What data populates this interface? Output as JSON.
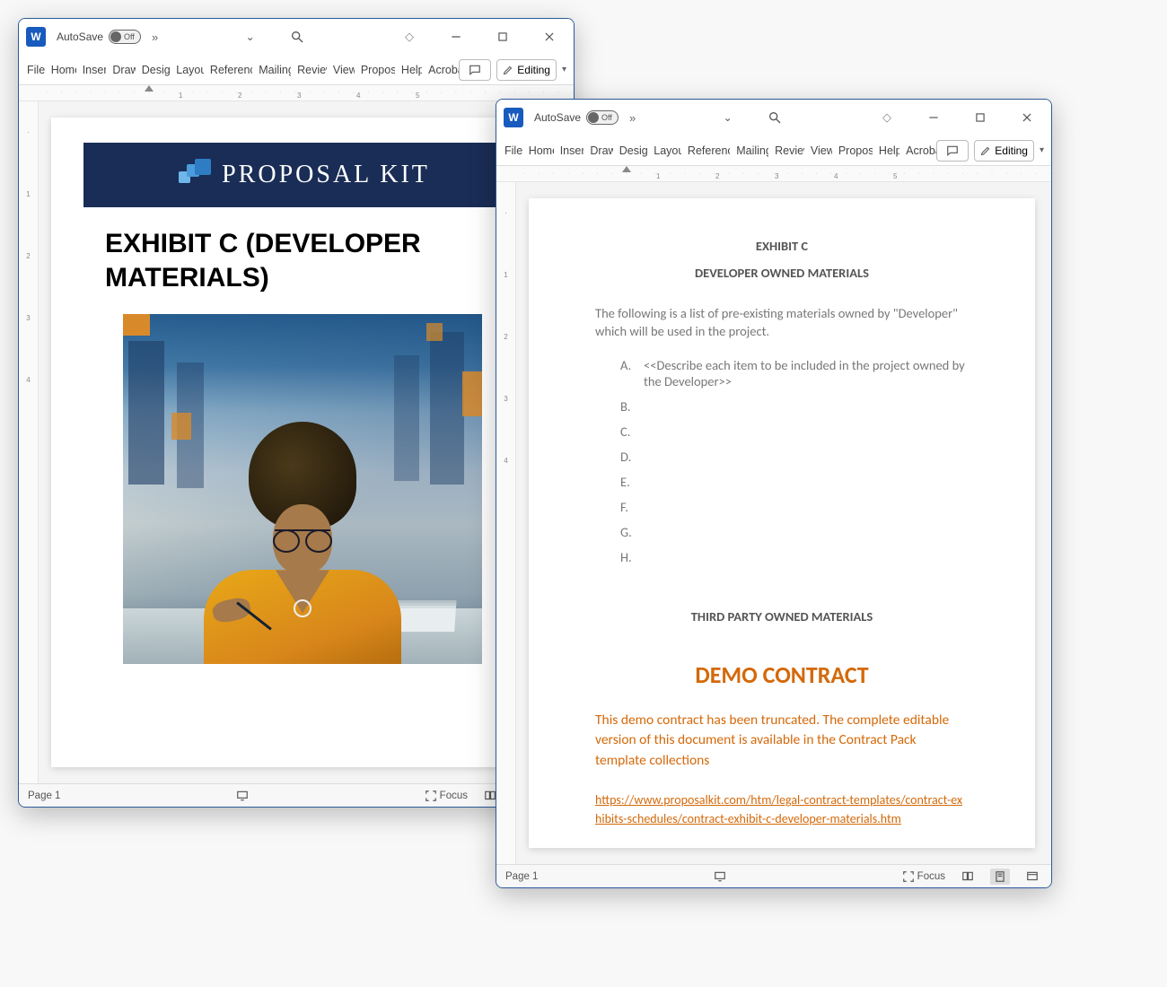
{
  "windows": {
    "win1": {
      "autosave_label": "AutoSave",
      "autosave_state": "Off",
      "ribbon_tabs": [
        "File",
        "Home",
        "Insert",
        "Draw",
        "Design",
        "Layout",
        "References",
        "Mailings",
        "Review",
        "View",
        "Proposal",
        "Help",
        "Acrobat"
      ],
      "editing_label": "Editing",
      "status_page": "Page 1",
      "status_focus": "Focus"
    },
    "win2": {
      "autosave_label": "AutoSave",
      "autosave_state": "Off",
      "ribbon_tabs": [
        "File",
        "Home",
        "Insert",
        "Draw",
        "Design",
        "Layout",
        "References",
        "Mailings",
        "Review",
        "View",
        "Proposal",
        "Help",
        "Acrobat"
      ],
      "editing_label": "Editing",
      "status_page": "Page 1",
      "status_focus": "Focus"
    }
  },
  "doc1": {
    "banner_brand": "PROPOSAL KIT",
    "title": "EXHIBIT C (DEVELOPER MATERIALS)"
  },
  "doc2": {
    "heading1": "EXHIBIT C",
    "heading2": "DEVELOPER OWNED MATERIALS",
    "intro": "The following is a list of pre-existing materials owned by \"Developer\" which will be used in the project.",
    "list": {
      "a": "<<Describe each item to be included in the project owned by the Developer>>",
      "b": "",
      "c": "",
      "d": "",
      "e": "",
      "f": "",
      "g": "",
      "h": ""
    },
    "heading3": "THIRD PARTY OWNED MATERIALS",
    "demo_title": "DEMO CONTRACT",
    "demo_body": "This demo contract has been truncated. The complete editable version of this document is available in the Contract Pack template collections",
    "demo_link": "https://www.proposalkit.com/htm/legal-contract-templates/contract-exhibits-schedules/contract-exhibit-c-developer-materials.htm"
  },
  "ruler_nums": [
    "1",
    "2",
    "3",
    "4",
    "5"
  ],
  "colors": {
    "word_blue": "#185abd",
    "border_blue": "#2a5a9a",
    "pk_navy": "#1a2d56",
    "demo_orange": "#d4690a"
  }
}
